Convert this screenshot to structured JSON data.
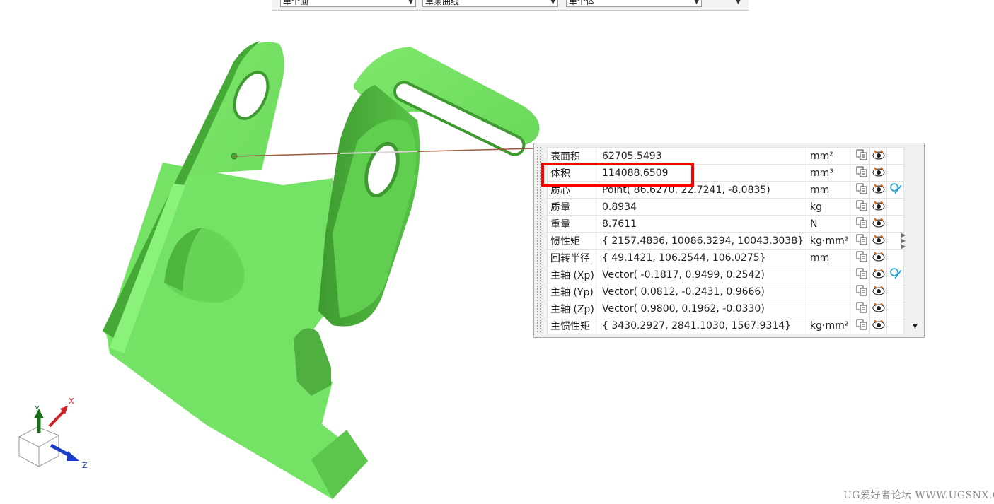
{
  "toolbar": {
    "filter_face": "单个面",
    "filter_curve": "单条曲线",
    "filter_body": "单个体"
  },
  "colors": {
    "part_green": "#70e060",
    "part_shadow": "#3f9a30",
    "highlight_red": "#ff0000",
    "leader": "#9a5a3a"
  },
  "triad": {
    "x": "X",
    "y": "Y",
    "z": "Z"
  },
  "properties": [
    {
      "name": "表面积",
      "value": "62705.5493",
      "unit": "mm²",
      "filter": false
    },
    {
      "name": "体积",
      "value": "114088.6509",
      "unit": "mm³",
      "filter": false
    },
    {
      "name": "质心",
      "value": "Point( 86.6270, 22.7241, -8.0835)",
      "unit": "mm",
      "filter": true
    },
    {
      "name": "质量",
      "value": "0.8934",
      "unit": "kg",
      "filter": false
    },
    {
      "name": "重量",
      "value": "8.7611",
      "unit": "N",
      "filter": false
    },
    {
      "name": "惯性矩",
      "value": "{ 2157.4836, 10086.3294, 10043.3038}",
      "unit": "kg·mm²",
      "filter": false
    },
    {
      "name": "回转半径",
      "value": "{ 49.1421, 106.2544, 106.0275}",
      "unit": "mm",
      "filter": false
    },
    {
      "name": "主轴 (Xp)",
      "value": "Vector( -0.1817, 0.9499, 0.2542)",
      "unit": "",
      "filter": true
    },
    {
      "name": "主轴 (Yp)",
      "value": "Vector( 0.0812, -0.2431, 0.9666)",
      "unit": "",
      "filter": false
    },
    {
      "name": "主轴 (Zp)",
      "value": "Vector( 0.9800, 0.1962, -0.0330)",
      "unit": "",
      "filter": false
    },
    {
      "name": "主惯性矩",
      "value": "{ 3430.2927, 2841.1030, 1567.9314}",
      "unit": "kg·mm²",
      "filter": false
    }
  ],
  "icons": {
    "copy": "copy-to-clipboard-icon",
    "show": "show-result-icon",
    "filter": "filter-icon"
  },
  "watermark": "UG爱好者论坛 WWW.UGSNX.COM"
}
